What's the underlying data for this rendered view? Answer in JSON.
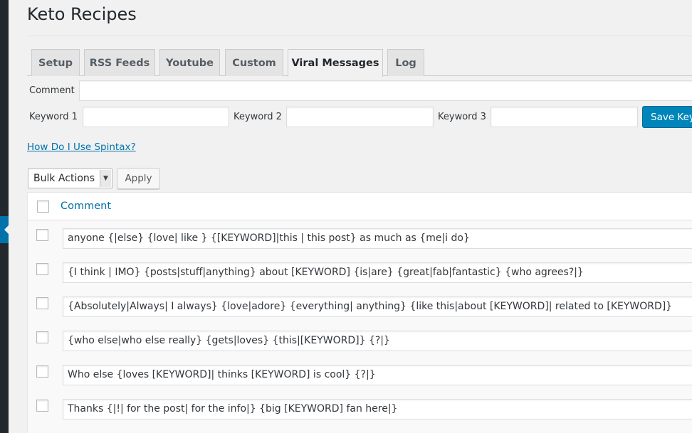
{
  "page": {
    "title": "Keto Recipes"
  },
  "tabs": [
    {
      "label": "Setup"
    },
    {
      "label": "RSS Feeds"
    },
    {
      "label": "Youtube"
    },
    {
      "label": "Custom"
    },
    {
      "label": "Viral Messages",
      "active": true
    },
    {
      "label": "Log"
    }
  ],
  "form": {
    "comment_label": "Comment",
    "comment_value": "",
    "keyword1_label": "Keyword 1",
    "keyword1_value": "",
    "keyword2_label": "Keyword 2",
    "keyword2_value": "",
    "keyword3_label": "Keyword 3",
    "keyword3_value": "",
    "save_label": "Save Keywords"
  },
  "help_link": "How Do I Use Spintax?",
  "bulk": {
    "selected": "Bulk Actions",
    "apply_label": "Apply"
  },
  "table": {
    "column_header": "Comment",
    "rows": [
      "anyone {|else} {love| like } {[KEYWORD]|this | this post} as much as {me|i do}",
      "{I think | IMO} {posts|stuff|anything} about [KEYWORD] {is|are} {great|fab|fantastic} {who agrees?|}",
      "{Absolutely|Always| I always} {love|adore} {everything| anything} {like this|about [KEYWORD]| related to [KEYWORD]}",
      "{who else|who else really} {gets|loves} {this|[KEYWORD]} {?|}",
      "Who else {loves [KEYWORD]| thinks [KEYWORD] is cool} {?|}",
      "Thanks {|!| for the post| for the info|} {big [KEYWORD] fan here|}"
    ]
  },
  "colors": {
    "accent": "#0073aa",
    "primary_button": "#0085ba",
    "sidebar": "#23282d",
    "background": "#f1f1f1"
  }
}
